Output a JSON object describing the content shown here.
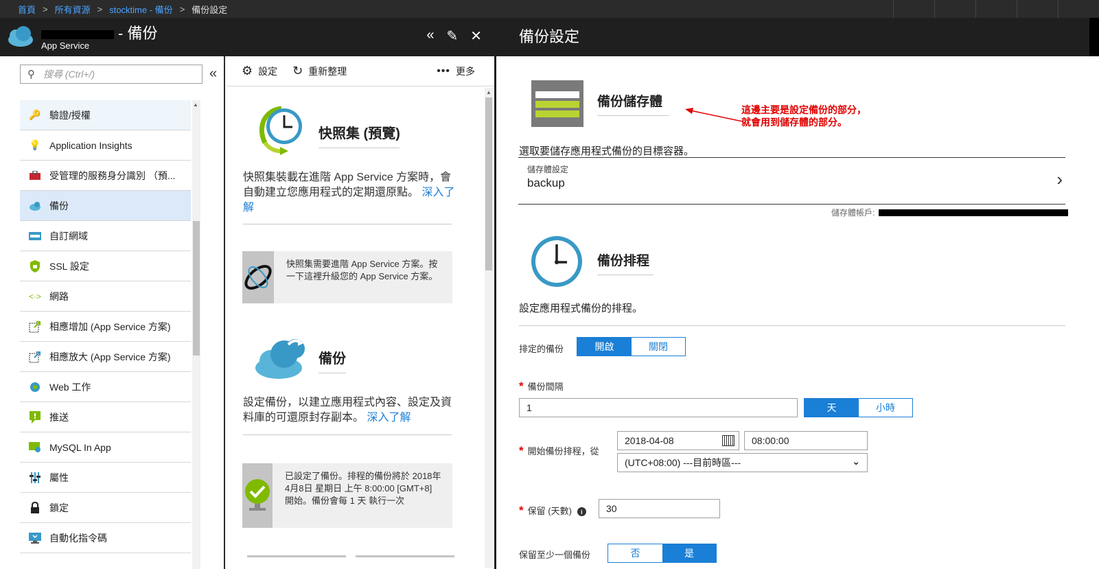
{
  "breadcrumb": {
    "home": "首頁",
    "all_resources": "所有資源",
    "resource": "stocktime - 備份",
    "current": "備份設定"
  },
  "left_header": {
    "title": "- 備份",
    "subtitle": "App Service"
  },
  "right_header": {
    "title": "備份設定"
  },
  "search": {
    "placeholder": "搜尋 (Ctrl+/)"
  },
  "nav": {
    "items": [
      {
        "label": "驗證/授權",
        "icon": "key-icon"
      },
      {
        "label": "Application Insights",
        "icon": "lightbulb-icon"
      },
      {
        "label": "受管理的服務身分識別 （預...",
        "icon": "toolbox-icon"
      },
      {
        "label": "備份",
        "icon": "cloud-backup-icon"
      },
      {
        "label": "自訂網域",
        "icon": "www-icon"
      },
      {
        "label": "SSL 設定",
        "icon": "shield-lock-icon"
      },
      {
        "label": "網路",
        "icon": "network-icon"
      },
      {
        "label": "相應增加 (App Service 方案)",
        "icon": "scale-up-icon"
      },
      {
        "label": "相應放大 (App Service 方案)",
        "icon": "scale-out-icon"
      },
      {
        "label": "Web 工作",
        "icon": "webjobs-icon"
      },
      {
        "label": "推送",
        "icon": "push-icon"
      },
      {
        "label": "MySQL In App",
        "icon": "mysql-icon"
      },
      {
        "label": "屬性",
        "icon": "properties-icon"
      },
      {
        "label": "鎖定",
        "icon": "lock-icon"
      },
      {
        "label": "自動化指令碼",
        "icon": "automation-icon"
      }
    ]
  },
  "toolbar": {
    "settings": "設定",
    "refresh": "重新整理",
    "more": "更多"
  },
  "snapshots": {
    "title": "快照集 (預覽)",
    "desc": "快照集裝載在進階 App Service 方案時，會自動建立您應用程式的定期還原點。",
    "learn_more": "深入了解",
    "notice": "快照集需要進階 App Service 方案。按一下這裡升級您的 App Service 方案。"
  },
  "backup": {
    "title": "備份",
    "desc": "設定備份，以建立應用程式內容、設定及資料庫的可還原封存副本。",
    "learn_more": "深入了解",
    "notice": "已設定了備份。排程的備份將於 2018年4月8日 星期日 上午 8:00:00 [GMT+8] 開始。備份會每 1 天 執行一次"
  },
  "storage": {
    "title": "備份儲存體",
    "desc": "選取要儲存應用程式備份的目標容器。",
    "setting_label": "儲存體設定",
    "setting_value": "backup",
    "account_label": "儲存體帳戶:"
  },
  "annotation": {
    "line1": "這邊主要是設定備份的部分，",
    "line2": "就會用到儲存體的部分。"
  },
  "schedule": {
    "title": "備份排程",
    "desc": "設定應用程式備份的排程。",
    "scheduled_label": "排定的備份",
    "on": "開啟",
    "off": "關閉",
    "interval_label": "備份間隔",
    "interval_value": "1",
    "unit_day": "天",
    "unit_hour": "小時",
    "start_label": "開始備份排程，從",
    "start_date": "2018-04-08",
    "start_time": "08:00:00",
    "timezone": "(UTC+08:00) ---目前時區---",
    "retention_label": "保留 (天數)",
    "retention_value": "30",
    "keep_one_label": "保留至少一個備份",
    "no": "否",
    "yes": "是"
  },
  "colors": {
    "accent": "#1a7fd6",
    "header_bg": "#1f1f1f",
    "selected_bg": "#dbe9f8",
    "annotation": "#e00000"
  }
}
